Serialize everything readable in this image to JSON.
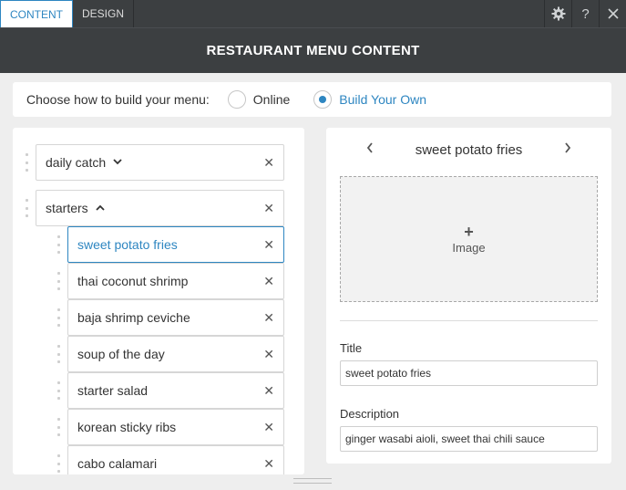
{
  "tabs": [
    {
      "label": "CONTENT",
      "active": true
    },
    {
      "label": "DESIGN",
      "active": false
    }
  ],
  "toolbar": {
    "settings_icon": "gear-icon",
    "help_label": "?",
    "close_icon": "close-icon"
  },
  "header": {
    "title": "RESTAURANT MENU CONTENT"
  },
  "choose": {
    "question": "Choose how to build your menu:",
    "options": [
      {
        "label": "Online",
        "selected": false
      },
      {
        "label": "Build Your Own",
        "selected": true
      }
    ]
  },
  "menu": {
    "sections": [
      {
        "name": "daily catch",
        "expanded": false
      },
      {
        "name": "starters",
        "expanded": true
      }
    ],
    "items": [
      {
        "name": "sweet potato fries",
        "selected": true
      },
      {
        "name": "thai coconut shrimp",
        "selected": false
      },
      {
        "name": "baja shrimp ceviche",
        "selected": false
      },
      {
        "name": "soup of the day",
        "selected": false
      },
      {
        "name": "starter salad",
        "selected": false
      },
      {
        "name": "korean sticky ribs",
        "selected": false
      },
      {
        "name": "cabo calamari",
        "selected": false
      }
    ]
  },
  "editor": {
    "item_name": "sweet potato fries",
    "image_plus": "+",
    "image_label": "Image",
    "title_label": "Title",
    "title_value": "sweet potato fries",
    "description_label": "Description",
    "description_value": "ginger wasabi aioli, sweet thai chili sauce"
  },
  "colors": {
    "accent": "#2e86c1",
    "dark": "#3c3f41"
  }
}
